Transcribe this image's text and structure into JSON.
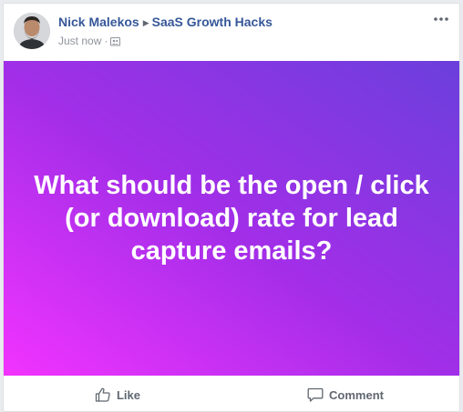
{
  "post": {
    "author": "Nick Malekos",
    "group": "SaaS Growth Hacks",
    "time": "Just now",
    "separator": "·",
    "audience_icon": "group-audience-icon",
    "more_icon": "more-options-icon"
  },
  "banner": {
    "text": "What should be the open / click (or download) rate for lead capture emails?",
    "gradient_colors": [
      "#f233ff",
      "#a32ee8",
      "#6b3fdc"
    ]
  },
  "actions": {
    "like_label": "Like",
    "comment_label": "Comment"
  },
  "colors": {
    "link": "#365899",
    "muted": "#90949c",
    "action_text": "#606770"
  }
}
